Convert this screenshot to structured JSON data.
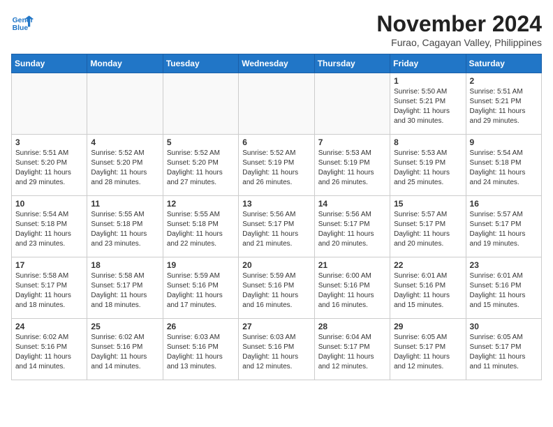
{
  "header": {
    "logo_line1": "General",
    "logo_line2": "Blue",
    "month_title": "November 2024",
    "location": "Furao, Cagayan Valley, Philippines"
  },
  "days_of_week": [
    "Sunday",
    "Monday",
    "Tuesday",
    "Wednesday",
    "Thursday",
    "Friday",
    "Saturday"
  ],
  "weeks": [
    [
      {
        "day": "",
        "info": ""
      },
      {
        "day": "",
        "info": ""
      },
      {
        "day": "",
        "info": ""
      },
      {
        "day": "",
        "info": ""
      },
      {
        "day": "",
        "info": ""
      },
      {
        "day": "1",
        "info": "Sunrise: 5:50 AM\nSunset: 5:21 PM\nDaylight: 11 hours and 30 minutes."
      },
      {
        "day": "2",
        "info": "Sunrise: 5:51 AM\nSunset: 5:21 PM\nDaylight: 11 hours and 29 minutes."
      }
    ],
    [
      {
        "day": "3",
        "info": "Sunrise: 5:51 AM\nSunset: 5:20 PM\nDaylight: 11 hours and 29 minutes."
      },
      {
        "day": "4",
        "info": "Sunrise: 5:52 AM\nSunset: 5:20 PM\nDaylight: 11 hours and 28 minutes."
      },
      {
        "day": "5",
        "info": "Sunrise: 5:52 AM\nSunset: 5:20 PM\nDaylight: 11 hours and 27 minutes."
      },
      {
        "day": "6",
        "info": "Sunrise: 5:52 AM\nSunset: 5:19 PM\nDaylight: 11 hours and 26 minutes."
      },
      {
        "day": "7",
        "info": "Sunrise: 5:53 AM\nSunset: 5:19 PM\nDaylight: 11 hours and 26 minutes."
      },
      {
        "day": "8",
        "info": "Sunrise: 5:53 AM\nSunset: 5:19 PM\nDaylight: 11 hours and 25 minutes."
      },
      {
        "day": "9",
        "info": "Sunrise: 5:54 AM\nSunset: 5:18 PM\nDaylight: 11 hours and 24 minutes."
      }
    ],
    [
      {
        "day": "10",
        "info": "Sunrise: 5:54 AM\nSunset: 5:18 PM\nDaylight: 11 hours and 23 minutes."
      },
      {
        "day": "11",
        "info": "Sunrise: 5:55 AM\nSunset: 5:18 PM\nDaylight: 11 hours and 23 minutes."
      },
      {
        "day": "12",
        "info": "Sunrise: 5:55 AM\nSunset: 5:18 PM\nDaylight: 11 hours and 22 minutes."
      },
      {
        "day": "13",
        "info": "Sunrise: 5:56 AM\nSunset: 5:17 PM\nDaylight: 11 hours and 21 minutes."
      },
      {
        "day": "14",
        "info": "Sunrise: 5:56 AM\nSunset: 5:17 PM\nDaylight: 11 hours and 20 minutes."
      },
      {
        "day": "15",
        "info": "Sunrise: 5:57 AM\nSunset: 5:17 PM\nDaylight: 11 hours and 20 minutes."
      },
      {
        "day": "16",
        "info": "Sunrise: 5:57 AM\nSunset: 5:17 PM\nDaylight: 11 hours and 19 minutes."
      }
    ],
    [
      {
        "day": "17",
        "info": "Sunrise: 5:58 AM\nSunset: 5:17 PM\nDaylight: 11 hours and 18 minutes."
      },
      {
        "day": "18",
        "info": "Sunrise: 5:58 AM\nSunset: 5:17 PM\nDaylight: 11 hours and 18 minutes."
      },
      {
        "day": "19",
        "info": "Sunrise: 5:59 AM\nSunset: 5:16 PM\nDaylight: 11 hours and 17 minutes."
      },
      {
        "day": "20",
        "info": "Sunrise: 5:59 AM\nSunset: 5:16 PM\nDaylight: 11 hours and 16 minutes."
      },
      {
        "day": "21",
        "info": "Sunrise: 6:00 AM\nSunset: 5:16 PM\nDaylight: 11 hours and 16 minutes."
      },
      {
        "day": "22",
        "info": "Sunrise: 6:01 AM\nSunset: 5:16 PM\nDaylight: 11 hours and 15 minutes."
      },
      {
        "day": "23",
        "info": "Sunrise: 6:01 AM\nSunset: 5:16 PM\nDaylight: 11 hours and 15 minutes."
      }
    ],
    [
      {
        "day": "24",
        "info": "Sunrise: 6:02 AM\nSunset: 5:16 PM\nDaylight: 11 hours and 14 minutes."
      },
      {
        "day": "25",
        "info": "Sunrise: 6:02 AM\nSunset: 5:16 PM\nDaylight: 11 hours and 14 minutes."
      },
      {
        "day": "26",
        "info": "Sunrise: 6:03 AM\nSunset: 5:16 PM\nDaylight: 11 hours and 13 minutes."
      },
      {
        "day": "27",
        "info": "Sunrise: 6:03 AM\nSunset: 5:16 PM\nDaylight: 11 hours and 12 minutes."
      },
      {
        "day": "28",
        "info": "Sunrise: 6:04 AM\nSunset: 5:17 PM\nDaylight: 11 hours and 12 minutes."
      },
      {
        "day": "29",
        "info": "Sunrise: 6:05 AM\nSunset: 5:17 PM\nDaylight: 11 hours and 12 minutes."
      },
      {
        "day": "30",
        "info": "Sunrise: 6:05 AM\nSunset: 5:17 PM\nDaylight: 11 hours and 11 minutes."
      }
    ]
  ]
}
